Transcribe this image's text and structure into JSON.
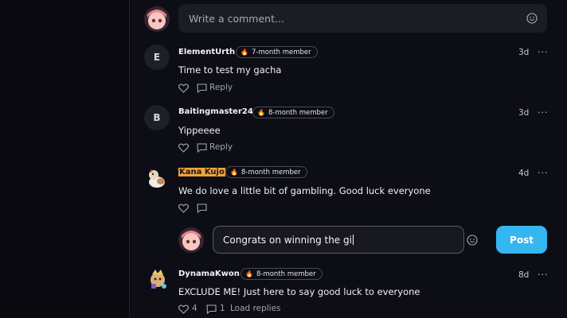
{
  "compose": {
    "placeholder": "Write a comment..."
  },
  "comments": [
    {
      "avatar_letter": "E",
      "username": "ElementUrth",
      "badge": "7-month member",
      "time": "3d",
      "text": "Time to test my gacha",
      "reply_label": "Reply"
    },
    {
      "avatar_letter": "B",
      "username": "Baitingmaster24",
      "badge": "8-month member",
      "time": "3d",
      "text": "Yippeeee",
      "reply_label": "Reply"
    },
    {
      "username": "Kana Kujo",
      "badge": "8-month member",
      "time": "4d",
      "text": "We do love a little bit of gambling. Good luck everyone"
    },
    {
      "username": "DynamaKwon",
      "badge": "8-month member",
      "time": "8d",
      "text": "EXCLUDE ME! Just here to say good luck to everyone",
      "like_count": "4",
      "reply_count": "1",
      "load_replies_label": "Load replies"
    }
  ],
  "reply_compose": {
    "value": "Congrats on winning the gi",
    "post_label": "Post"
  },
  "more_glyph": "···",
  "colors": {
    "post_button": "#34b6f0",
    "username_highlight": "#f0a23c",
    "badge_flame": "#ff7a2a"
  }
}
